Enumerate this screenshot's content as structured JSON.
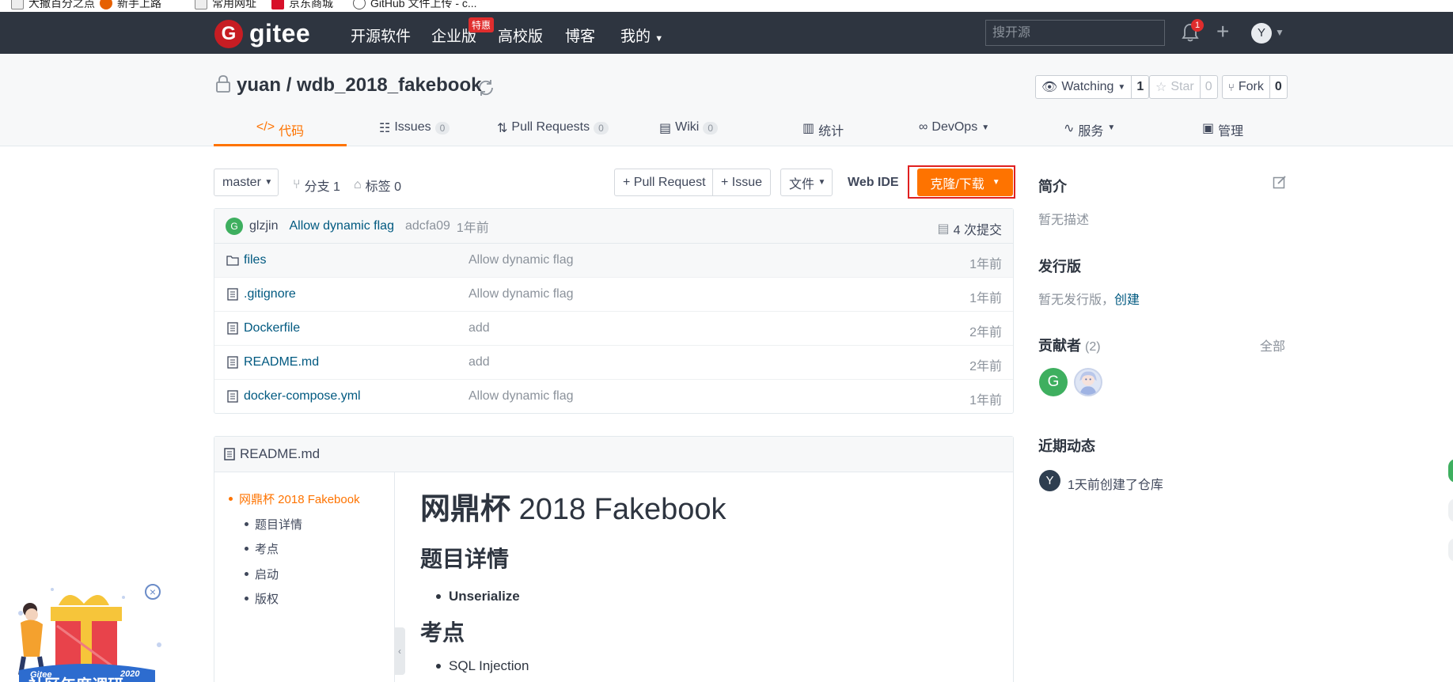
{
  "bookmarks": [
    "大撒百分之点",
    "新手上路",
    "常用网址",
    "京东商城",
    "GitHub 文件上传 - c..."
  ],
  "navbar": {
    "logo_letter": "G",
    "logo_text": "gitee",
    "items": [
      "开源软件",
      "企业版",
      "高校版",
      "博客",
      "我的"
    ],
    "hot_badge": "特惠",
    "search_placeholder": "搜开源",
    "notification_count": "1",
    "user_initial": "Y"
  },
  "repo": {
    "owner": "yuan",
    "separator": "/",
    "name": "wdb_2018_fakebook",
    "watch": {
      "label": "Watching",
      "count": "1"
    },
    "star": {
      "label": "Star",
      "count": "0"
    },
    "fork": {
      "label": "Fork",
      "count": "0"
    }
  },
  "tabs": [
    {
      "label": "代码",
      "icon": "code-icon"
    },
    {
      "label": "Issues",
      "count": "0",
      "icon": "issues-icon"
    },
    {
      "label": "Pull Requests",
      "count": "0",
      "icon": "pull-request-icon"
    },
    {
      "label": "Wiki",
      "count": "0",
      "icon": "wiki-icon"
    },
    {
      "label": "统计",
      "icon": "chart-icon"
    },
    {
      "label": "DevOps",
      "icon": "devops-icon"
    },
    {
      "label": "服务",
      "icon": "pulse-icon"
    },
    {
      "label": "管理",
      "icon": "settings-doc-icon"
    }
  ],
  "toolbar": {
    "branch": "master",
    "branches_label": "分支 1",
    "tags_label": "标签 0",
    "pull_request": "+ Pull Request",
    "issue": "+ Issue",
    "file": "文件",
    "web_ide": "Web IDE",
    "clone": "克隆/下载"
  },
  "commit": {
    "avatar_initial": "G",
    "author": "glzjin",
    "message": "Allow dynamic flag",
    "hash": "adcfa09",
    "time": "1年前",
    "count_label": "4 次提交"
  },
  "files": [
    {
      "name": "files",
      "type": "folder",
      "message": "Allow dynamic flag",
      "time": "1年前"
    },
    {
      "name": ".gitignore",
      "type": "file",
      "message": "Allow dynamic flag",
      "time": "1年前"
    },
    {
      "name": "Dockerfile",
      "type": "file",
      "message": "add",
      "time": "2年前"
    },
    {
      "name": "README.md",
      "type": "file",
      "message": "add",
      "time": "2年前"
    },
    {
      "name": "docker-compose.yml",
      "type": "file",
      "message": "Allow dynamic flag",
      "time": "1年前"
    }
  ],
  "readme": {
    "filename": "README.md",
    "toc": [
      "网鼎杯 2018 Fakebook",
      "题目详情",
      "考点",
      "启动",
      "版权"
    ],
    "title_cjk": "网鼎杯",
    "title_rest": " 2018 Fakebook",
    "h2_details": "题目详情",
    "li_details": "Unserialize",
    "h2_points": "考点",
    "li_points": "SQL Injection"
  },
  "sidebar": {
    "intro_title": "简介",
    "intro_text": "暂无描述",
    "release_title": "发行版",
    "release_text": "暂无发行版，",
    "release_link": "创建",
    "contrib_title": "贡献者",
    "contrib_count": "(2)",
    "contrib_all": "全部",
    "contrib_initial": "G",
    "activity_title": "近期动态",
    "activity_initial": "Y",
    "activity_text": "1天前创建了仓库"
  },
  "promo": {
    "brand": "Gitee",
    "year": "2020",
    "title": "社区年度调研"
  },
  "colors": {
    "navbar_bg": "#2e3540",
    "accent_orange": "#fe7300",
    "link_blue": "#005980",
    "brand_red": "#c71d23",
    "highlight_red": "#e02020"
  }
}
